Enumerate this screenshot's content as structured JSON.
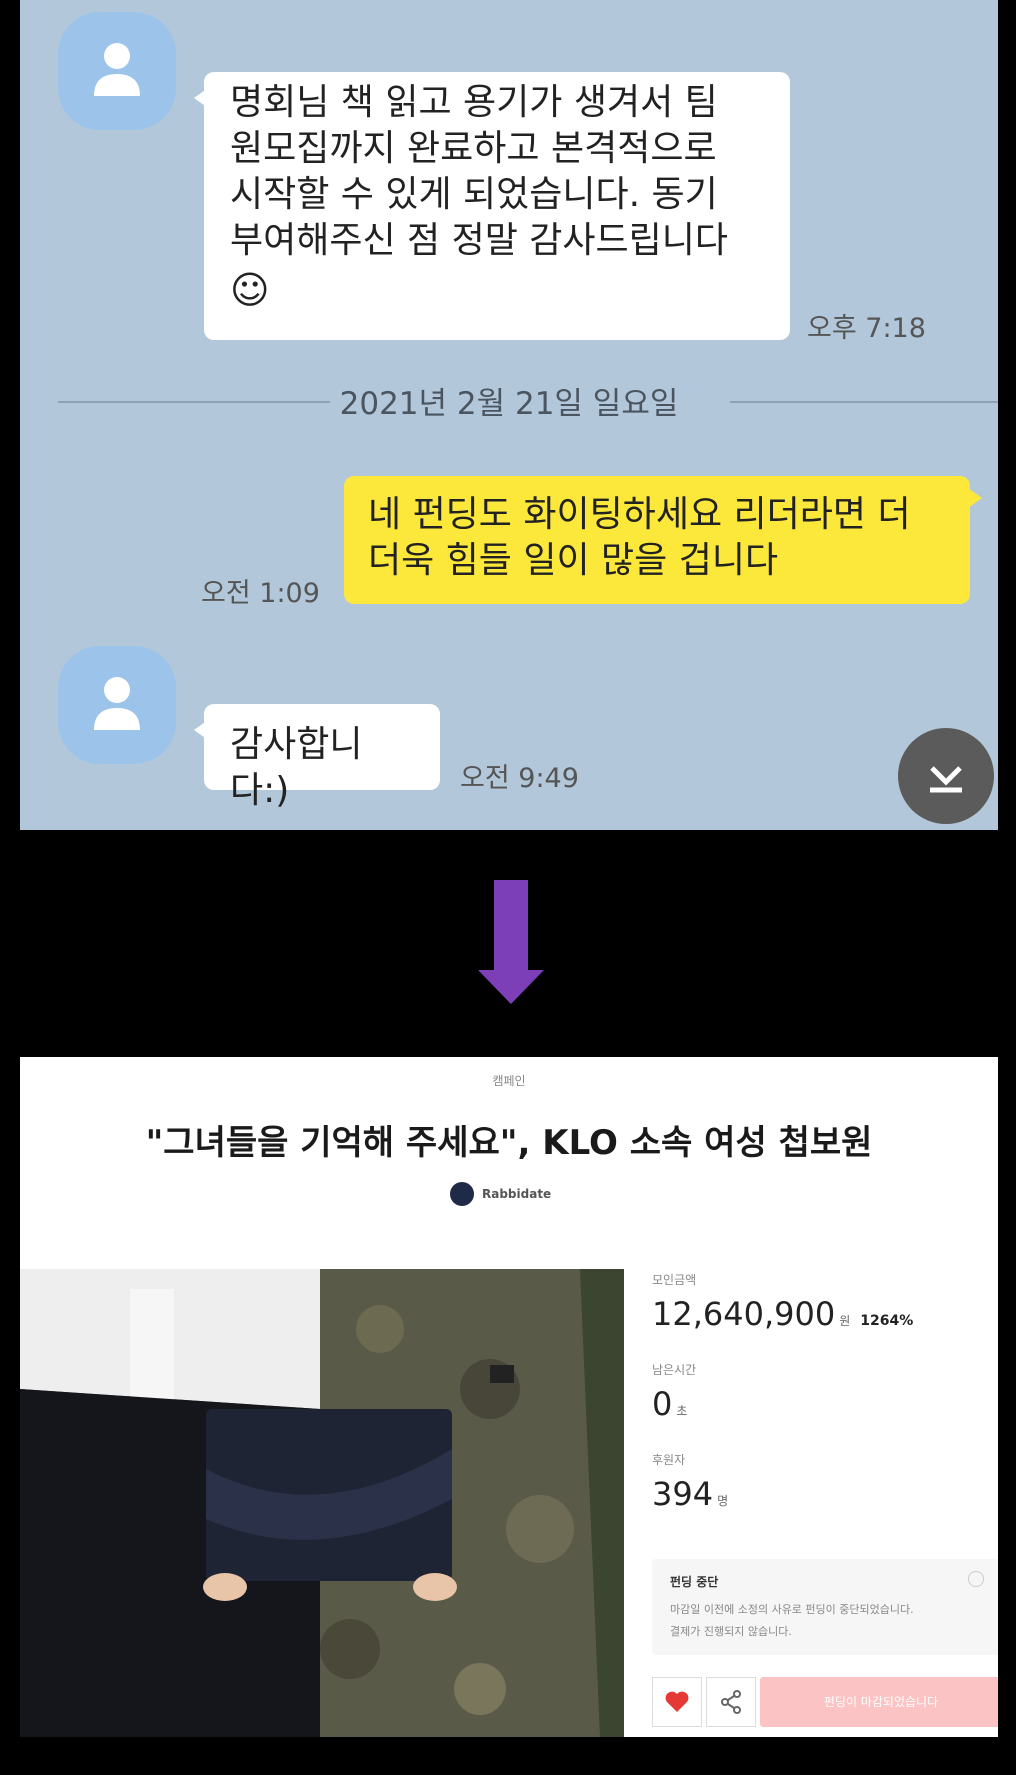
{
  "chat": {
    "messages": [
      {
        "from": "other",
        "lines": [
          "명회님 책 읽고 용기가 생겨서 팀",
          "원모집까지 완료하고 본격적으로",
          "시작할 수 있게 되었습니다. 동기",
          "부여해주신 점 정말 감사드립니다"
        ],
        "emoji": "☺",
        "time": "오후 7:18"
      },
      {
        "from": "me",
        "lines": [
          "네 펀딩도 화이팅하세요 리더라면 더",
          "더욱 힘들 일이 많을 겁니다"
        ],
        "time": "오전 1:09"
      },
      {
        "from": "other",
        "lines": [
          "감사합니다:)"
        ],
        "time": "오전 9:49"
      }
    ],
    "date_divider": "2021년 2월 21일 일요일",
    "scroll_icon": "scroll-to-bottom-icon"
  },
  "arrow": {
    "color": "#7d3fb8",
    "icon": "down-arrow"
  },
  "funding": {
    "category": "캠페인",
    "title": "\"그녀들을 기억해 주세요\", KLO 소속 여성 첩보원",
    "creator": "Rabbidate",
    "stats": [
      {
        "label": "모인금액",
        "value": "12,640,900",
        "unit": "원",
        "extra": "1264%"
      },
      {
        "label": "남은시간",
        "value": "0",
        "unit": "초"
      },
      {
        "label": "후원자",
        "value": "394",
        "unit": "명"
      }
    ],
    "notice": {
      "title": "펀딩 중단",
      "lines": [
        "마감일 이전에 소정의 사유로 펀딩이 중단되었습니다.",
        "결제가 진행되지 않습니다."
      ]
    },
    "buttons": {
      "like_icon": "heart-icon",
      "share_icon": "share-icon",
      "end_label": "펀딩이 마감되었습니다"
    }
  }
}
